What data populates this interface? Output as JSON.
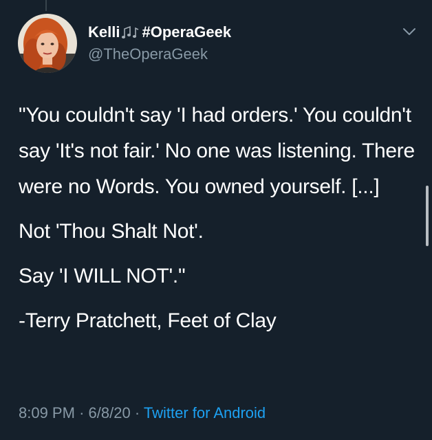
{
  "tweet": {
    "author": {
      "display_name_prefix": "Kelli",
      "display_name_emoji": "music-notes-emoji",
      "display_name_suffix": "#OperaGeek",
      "handle": "@TheOperaGeek"
    },
    "body": [
      "\"You couldn't say 'I had orders.' You couldn't say 'It's not fair.' No one was listening. There were no Words. You owned yourself. [...]",
      "Not 'Thou Shalt Not'.",
      "Say 'I WILL NOT'.\"",
      "-Terry Pratchett, Feet of Clay"
    ],
    "meta": {
      "time": "8:09 PM",
      "separator": "·",
      "date": "6/8/20",
      "source": "Twitter for Android"
    }
  },
  "icons": {
    "more_options": "chevron-down-icon"
  },
  "colors": {
    "background": "#15202b",
    "text_primary": "#ffffff",
    "text_secondary": "#8899a6",
    "link": "#1da1f2"
  }
}
